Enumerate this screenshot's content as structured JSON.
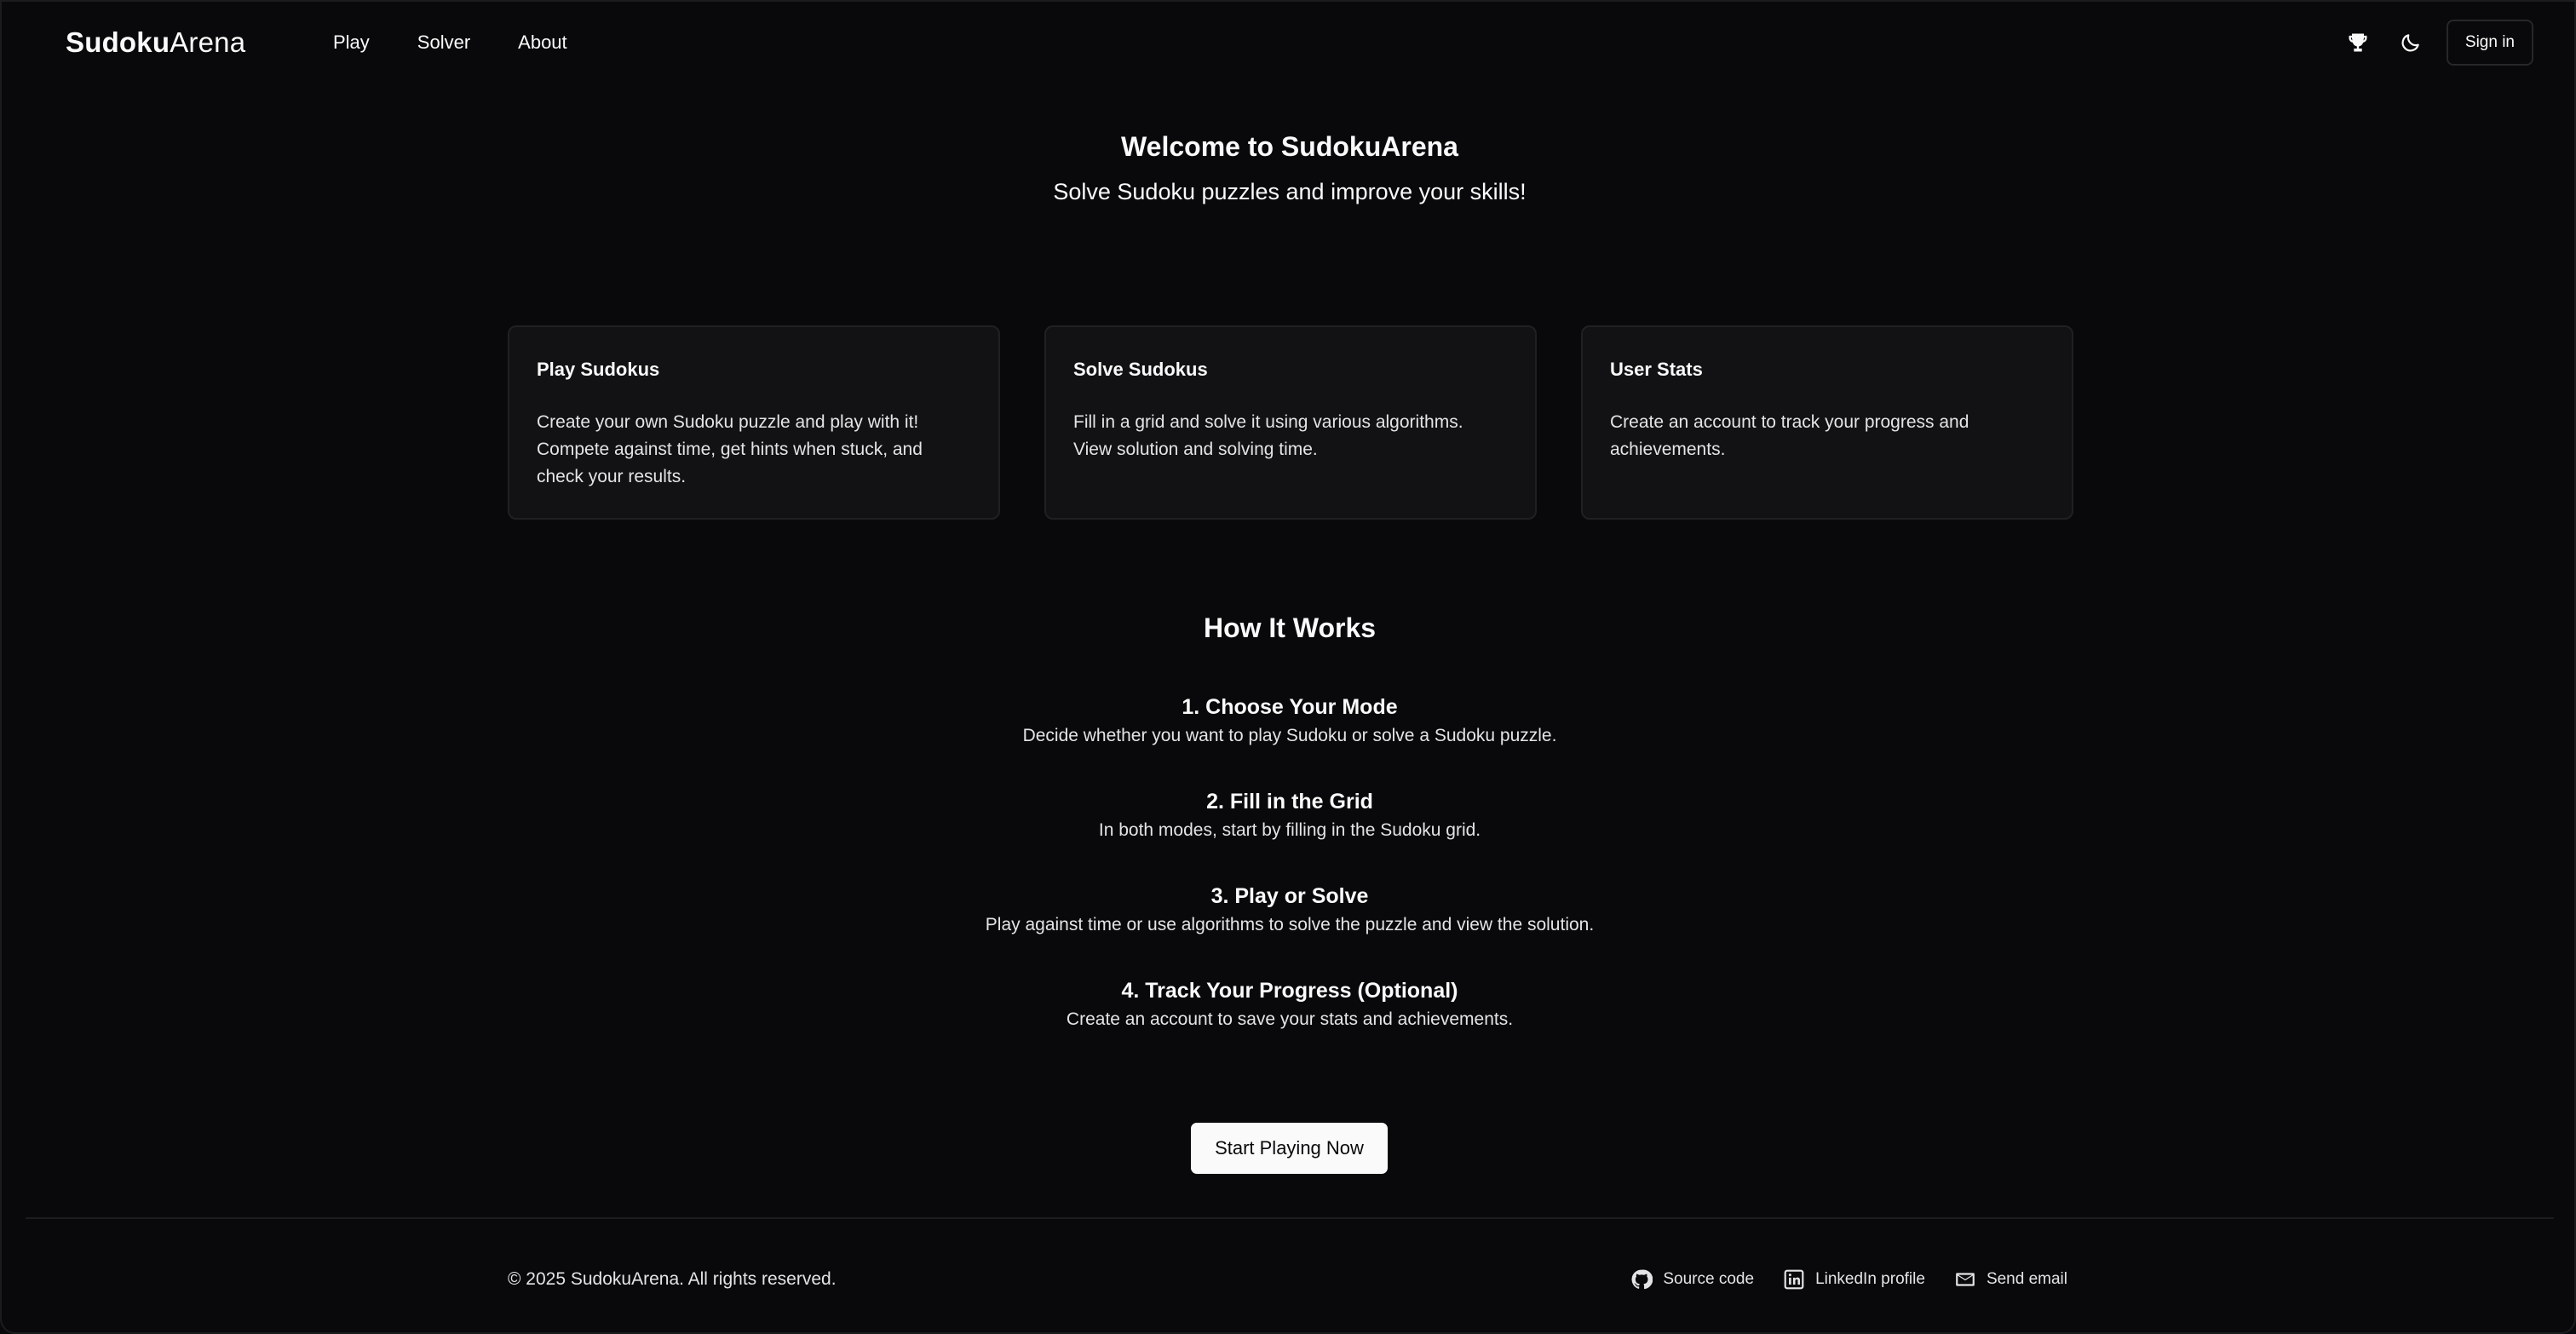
{
  "header": {
    "logo_bold": "Sudoku",
    "logo_light": "Arena",
    "nav": [
      {
        "label": "Play"
      },
      {
        "label": "Solver"
      },
      {
        "label": "About"
      }
    ],
    "icons": {
      "leaderboard": "trophy-icon",
      "theme": "moon-icon"
    },
    "sign_in_label": "Sign in"
  },
  "hero": {
    "title": "Welcome to SudokuArena",
    "subtitle": "Solve Sudoku puzzles and improve your skills!"
  },
  "cards": [
    {
      "title": "Play Sudokus",
      "lines": [
        "Create your own Sudoku puzzle and play with it!",
        "Compete against time, get hints when stuck, and",
        "check your results."
      ]
    },
    {
      "title": "Solve Sudokus",
      "lines": [
        "Fill in a grid and solve it using various algorithms.",
        "View solution and solving time."
      ]
    },
    {
      "title": "User Stats",
      "lines": [
        "Create an account to track your progress and",
        "achievements."
      ]
    }
  ],
  "how_it_works": {
    "title": "How It Works",
    "steps": [
      {
        "title": "1. Choose Your Mode",
        "desc": "Decide whether you want to play Sudoku or solve a Sudoku puzzle."
      },
      {
        "title": "2. Fill in the Grid",
        "desc": "In both modes, start by filling in the Sudoku grid."
      },
      {
        "title": "3. Play or Solve",
        "desc": "Play against time or use algorithms to solve the puzzle and view the solution."
      },
      {
        "title": "4. Track Your Progress (Optional)",
        "desc": "Create an account to save your stats and achievements."
      }
    ]
  },
  "cta_label": "Start Playing Now",
  "footer": {
    "copyright": "© 2025 SudokuArena. All rights reserved.",
    "links": [
      {
        "label": "Source code",
        "icon": "github-icon"
      },
      {
        "label": "LinkedIn profile",
        "icon": "linkedin-icon"
      },
      {
        "label": "Send email",
        "icon": "mail-icon"
      }
    ]
  },
  "colors": {
    "background": "#09090b",
    "card_background": "#121214",
    "border": "#27272a",
    "text": "#fafafa",
    "cta_background": "#fafafa"
  }
}
